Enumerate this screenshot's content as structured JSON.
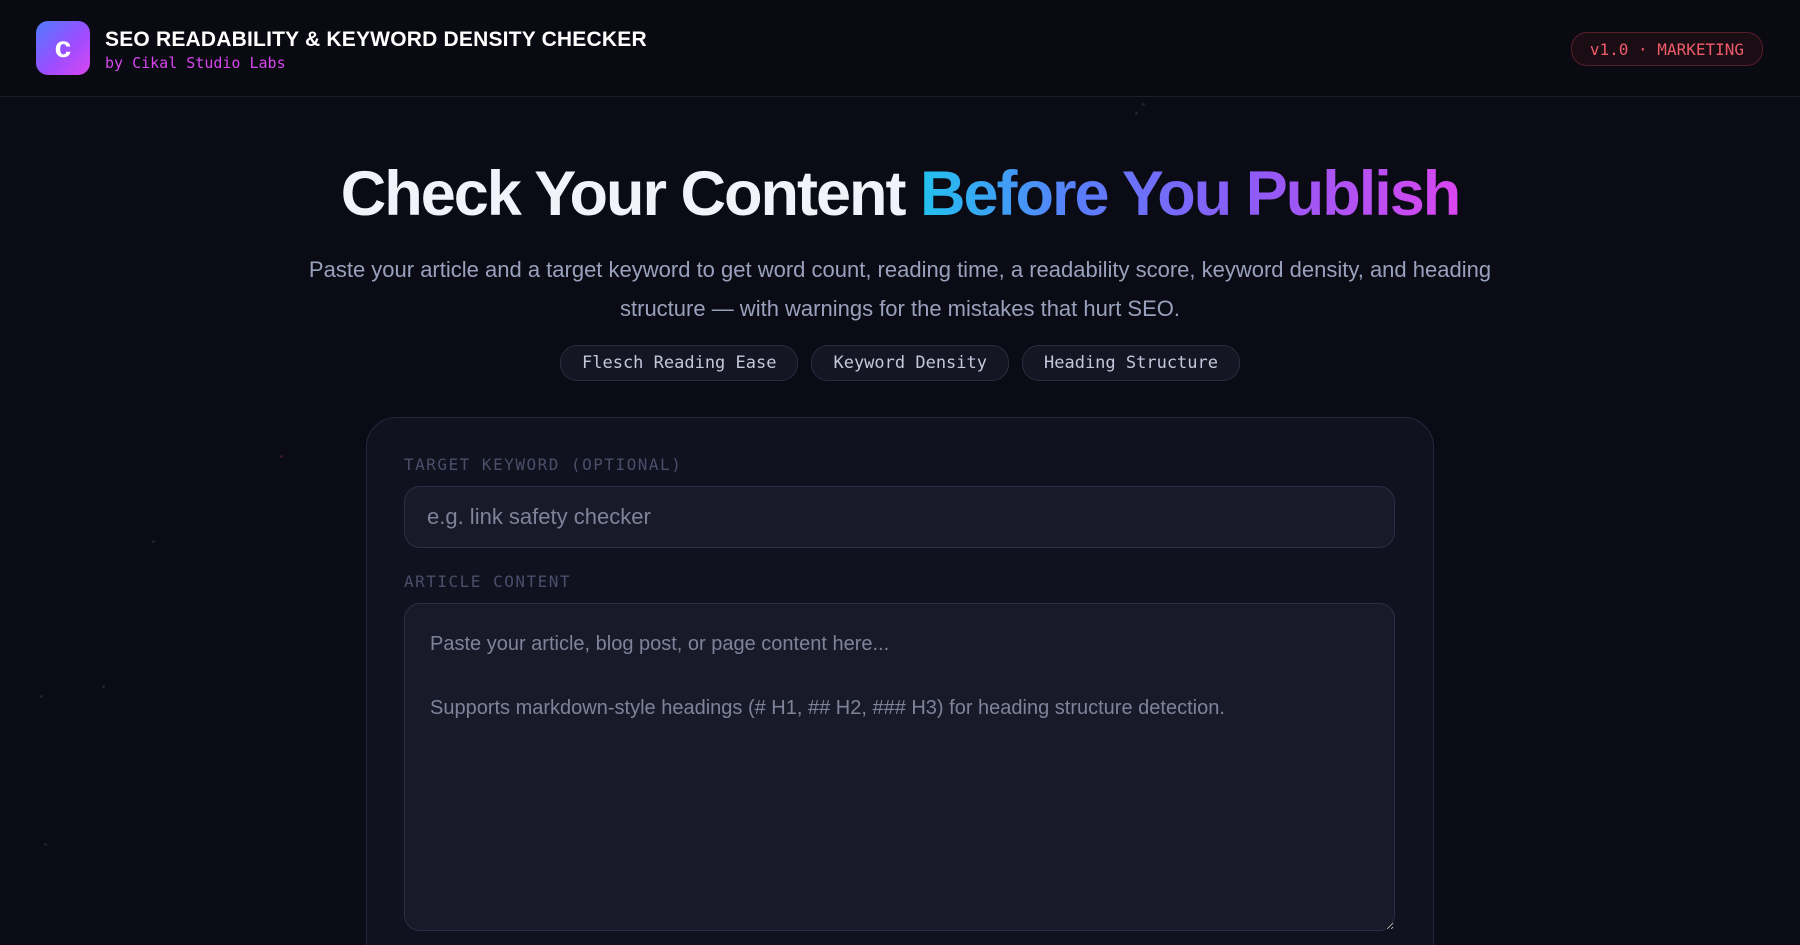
{
  "header": {
    "logo_letter": "c",
    "app_title": "SEO READABILITY & KEYWORD DENSITY CHECKER",
    "app_subtitle": "by Cikal Studio Labs",
    "version_badge": "v1.0 · MARKETING"
  },
  "hero": {
    "title_plain": "Check Your Content ",
    "title_gradient": "Before You Publish",
    "description": "Paste your article and a target keyword to get word count, reading time, a readability score, keyword density, and heading structure — with warnings for the mistakes that hurt SEO.",
    "pills": [
      "Flesch Reading Ease",
      "Keyword Density",
      "Heading Structure"
    ]
  },
  "form": {
    "keyword_label": "TARGET KEYWORD (OPTIONAL)",
    "keyword_placeholder": "e.g. link safety checker",
    "content_label": "ARTICLE CONTENT",
    "content_placeholder": "Paste your article, blog post, or page content here...\n\nSupports markdown-style headings (# H1, ## H2, ### H3) for heading structure detection."
  },
  "colors": {
    "background": "#0a0b14",
    "accent_magenta": "#d946ef",
    "accent_cyan": "#22c1ee",
    "badge_red": "#f05a6a"
  }
}
